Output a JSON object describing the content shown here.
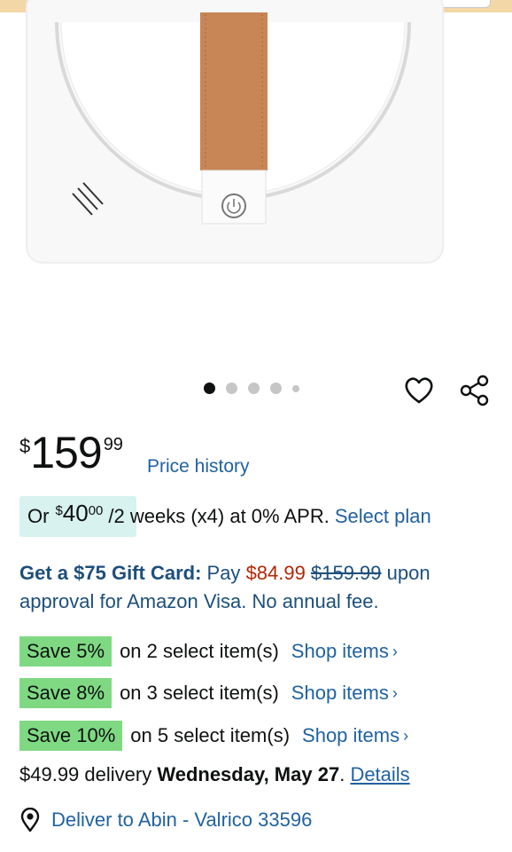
{
  "image_carousel": {
    "dot_count": 5,
    "active_index": 0
  },
  "icons": {
    "wishlist": "heart-icon",
    "share": "share-icon",
    "location": "location-pin-icon",
    "chevron": "chevron-right-icon"
  },
  "price": {
    "currency": "$",
    "whole": "159",
    "fraction": "99",
    "history_label": "Price history"
  },
  "installment": {
    "prefix": "Or",
    "currency": "$",
    "whole": "40",
    "fraction": "00",
    "terms": "/2 weeks (x4) at 0% APR.",
    "link": "Select plan"
  },
  "gift_card": {
    "bold": "Get a $75 Gift Card:",
    "pay": "Pay",
    "new_price": "$84.99",
    "old_price": "$159.99",
    "rest": "upon approval for Amazon Visa. No annual fee."
  },
  "savings": [
    {
      "badge": "Save 5%",
      "text": "on 2 select item(s)",
      "link": "Shop items",
      "chevron": "›"
    },
    {
      "badge": "Save 8%",
      "text": "on 3 select item(s)",
      "link": "Shop items",
      "chevron": "›"
    },
    {
      "badge": "Save 10%",
      "text": "on 5 select item(s)",
      "link": "Shop items",
      "chevron": "›"
    }
  ],
  "delivery": {
    "price": "$49.99 delivery",
    "date": "Wednesday, May 27",
    "period": ".",
    "link": "Details"
  },
  "deliver_to": {
    "label": "Deliver to Abin - Valrico 33596"
  },
  "colors": {
    "link": "#2162a1",
    "save_badge": "#7fd983",
    "installment_badge": "#d7f2ef",
    "strike_red": "#b12704"
  }
}
